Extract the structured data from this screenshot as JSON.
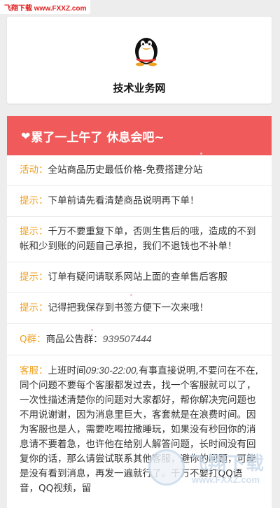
{
  "watermark_top": "飞翔下载 www.FXXZ.com",
  "header": {
    "title": "技术业务网"
  },
  "notice": {
    "banner": "累了一上午了 休息会吧~",
    "rows": [
      {
        "label": "活动：",
        "text": "全站商品历史最低价格-免费搭建分站"
      },
      {
        "label": "提示：",
        "text": "下单前请先看清楚商品说明再下单！"
      },
      {
        "label": "提示：",
        "text": "千万不要重复下单，否则生售后的哦，造成的不到帐和少到账的问题自己承担，我们不退钱也不补单！"
      },
      {
        "label": "提示：",
        "text": "订单有疑问请联系网站上面的查单售后客服"
      },
      {
        "label": "提示：",
        "text": "记得把我保存到书签方便下一次来哦！"
      }
    ],
    "qq_group": {
      "label": "Q群：",
      "prefix": "商品公告群：",
      "number": "939507444"
    },
    "service": {
      "label": "客服：",
      "before": "上班时间",
      "time": "09:30-22:00,",
      "after": "有事直接说明,不要问在不在,同个问题不要每个客服都发过去，找一个客服就可以了，一次性描述清楚你的问题对大家都好，帮你解决完问题也不用说谢谢，因为消息里巨大，客套就是在浪费时间。因为客服也是人，需要吃喝拉撒睡玩，如果没有秒回你的消息请不要着急，也许他在给别人解答问题，长时间没有回复你的话，那么请尝试联系其他客服，避你的问题，可能是没有看到消息，再发一遍就行了。千万不要打QQ语音，QQ视频，留"
    }
  },
  "watermark_bottom": {
    "text": "飞翔下载",
    "url": "www.FXXZ.com"
  }
}
